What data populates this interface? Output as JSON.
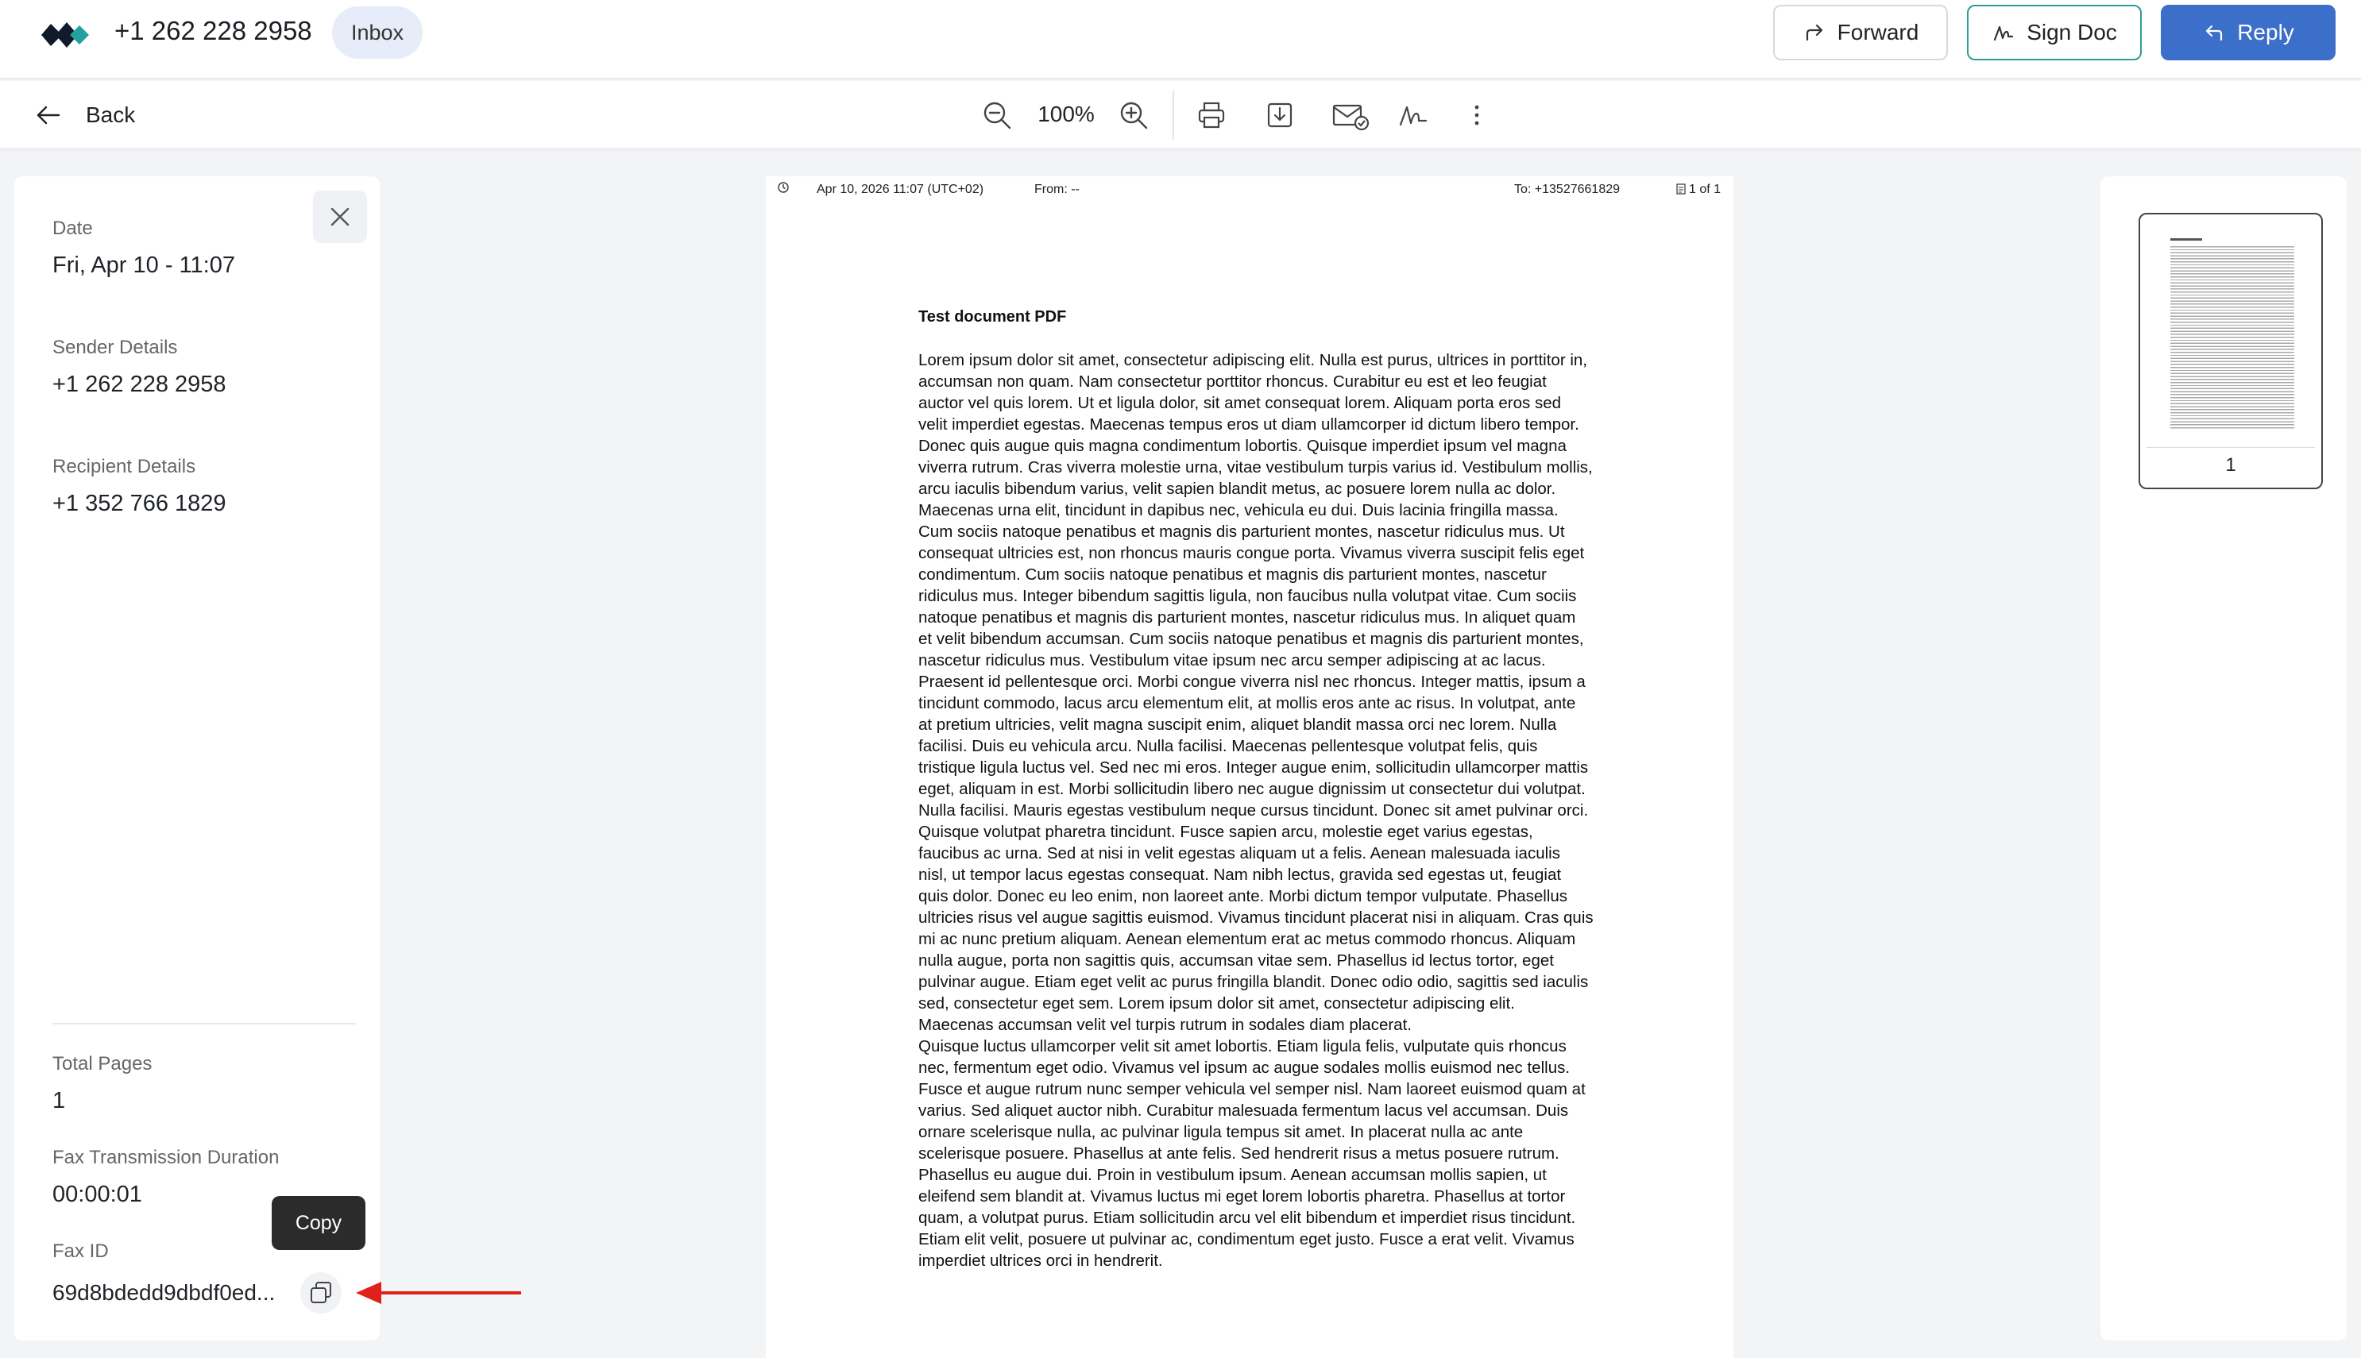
{
  "header": {
    "phone": "+1 262 228 2958",
    "badge": "Inbox",
    "forward_label": "Forward",
    "sign_label": "Sign Doc",
    "reply_label": "Reply"
  },
  "toolbar": {
    "back_label": "Back",
    "zoom": "100%"
  },
  "details": {
    "date_label": "Date",
    "date_value": "Fri, Apr 10 - 11:07",
    "sender_label": "Sender Details",
    "sender_value": "+1 262 228 2958",
    "recipient_label": "Recipient Details",
    "recipient_value": "+1 352 766 1829",
    "pages_label": "Total Pages",
    "pages_value": "1",
    "duration_label": "Fax Transmission Duration",
    "duration_value": "00:00:01",
    "faxid_label": "Fax ID",
    "faxid_value": "69d8bdedd9dbdf0ed...",
    "copy_tooltip": "Copy"
  },
  "document": {
    "header_date": "Apr 10, 2026 11:07 (UTC+02)",
    "header_from": "From:    --",
    "header_to": "To: +13527661829",
    "header_pages": "1 of 1",
    "title": "Test document PDF",
    "paragraphs": [
      "Lorem ipsum dolor sit amet, consectetur adipiscing elit. Nulla est purus, ultrices in porttitor in, accumsan non quam. Nam consectetur porttitor rhoncus. Curabitur eu est et leo feugiat auctor vel quis lorem. Ut et ligula dolor, sit amet consequat lorem. Aliquam porta eros sed velit imperdiet egestas. Maecenas tempus eros ut diam ullamcorper id dictum libero tempor. Donec quis augue quis magna condimentum lobortis. Quisque imperdiet ipsum vel magna viverra rutrum. Cras viverra molestie urna, vitae vestibulum turpis varius id. Vestibulum mollis, arcu iaculis bibendum varius, velit sapien blandit metus, ac posuere lorem nulla ac dolor. Maecenas urna elit, tincidunt in dapibus nec, vehicula eu dui. Duis lacinia fringilla massa. Cum sociis natoque penatibus et magnis dis parturient montes, nascetur ridiculus mus. Ut consequat ultricies est, non rhoncus mauris congue porta. Vivamus viverra suscipit felis eget condimentum. Cum sociis natoque penatibus et magnis dis parturient montes, nascetur ridiculus mus. Integer bibendum sagittis ligula, non faucibus nulla volutpat vitae. Cum sociis natoque penatibus et magnis dis parturient montes, nascetur ridiculus mus. In aliquet quam et velit bibendum accumsan. Cum sociis natoque penatibus et magnis dis parturient montes, nascetur ridiculus mus. Vestibulum vitae ipsum nec arcu semper adipiscing at ac lacus. Praesent id pellentesque orci. Morbi congue viverra nisl nec rhoncus. Integer mattis, ipsum a tincidunt commodo, lacus arcu elementum elit, at mollis eros ante ac risus. In volutpat, ante at pretium ultricies, velit magna suscipit enim, aliquet blandit massa orci nec lorem. Nulla facilisi. Duis eu vehicula arcu. Nulla facilisi. Maecenas pellentesque volutpat felis, quis tristique ligula luctus vel. Sed nec mi eros. Integer augue enim, sollicitudin ullamcorper mattis eget, aliquam in est. Morbi sollicitudin libero nec augue dignissim ut consectetur dui volutpat. Nulla facilisi. Mauris egestas vestibulum neque cursus tincidunt. Donec sit amet pulvinar orci.",
      "Quisque volutpat pharetra tincidunt. Fusce sapien arcu, molestie eget varius egestas, faucibus ac urna. Sed at nisi in velit egestas aliquam ut a felis. Aenean malesuada iaculis nisl, ut tempor lacus egestas consequat. Nam nibh lectus, gravida sed egestas ut, feugiat quis dolor. Donec eu leo enim, non laoreet ante. Morbi dictum tempor vulputate. Phasellus ultricies risus vel augue sagittis euismod. Vivamus tincidunt placerat nisi in aliquam. Cras quis mi ac nunc pretium aliquam. Aenean elementum erat ac metus commodo rhoncus. Aliquam nulla augue, porta non sagittis quis, accumsan vitae sem. Phasellus id lectus tortor, eget pulvinar augue. Etiam eget velit ac purus fringilla blandit. Donec odio odio, sagittis sed iaculis sed, consectetur eget sem. Lorem ipsum dolor sit amet, consectetur adipiscing elit. Maecenas accumsan velit vel turpis rutrum in sodales diam placerat.",
      "Quisque luctus ullamcorper velit sit amet lobortis. Etiam ligula felis, vulputate quis rhoncus nec, fermentum eget odio. Vivamus vel ipsum ac augue sodales mollis euismod nec tellus. Fusce et augue rutrum nunc semper vehicula vel semper nisl. Nam laoreet euismod quam at varius. Sed aliquet auctor nibh. Curabitur malesuada fermentum lacus vel accumsan. Duis ornare scelerisque nulla, ac pulvinar ligula tempus sit amet. In placerat nulla ac ante scelerisque posuere. Phasellus at ante felis. Sed hendrerit risus a metus posuere rutrum. Phasellus eu augue dui. Proin in vestibulum ipsum. Aenean accumsan mollis sapien, ut eleifend sem blandit at. Vivamus luctus mi eget lorem lobortis pharetra. Phasellus at tortor quam, a volutpat purus. Etiam sollicitudin arcu vel elit bibendum et imperdiet risus tincidunt. Etiam elit velit, posuere ut pulvinar ac, condimentum eget justo. Fusce a erat velit. Vivamus imperdiet ultrices orci in hendrerit."
    ]
  },
  "thumbnails": {
    "page_number": "1"
  },
  "colors": {
    "reply_bg": "#3b6fc9",
    "sign_border": "#2f9d9b",
    "annotation_arrow": "#e0201b"
  },
  "icons": [
    "logo-icon",
    "forward-icon",
    "signature-icon",
    "reply-icon",
    "back-arrow-icon",
    "zoom-out-icon",
    "zoom-in-icon",
    "print-icon",
    "download-icon",
    "email-check-icon",
    "signature-icon",
    "more-vertical-icon",
    "close-icon",
    "copy-icon",
    "clock-icon",
    "pages-icon"
  ]
}
